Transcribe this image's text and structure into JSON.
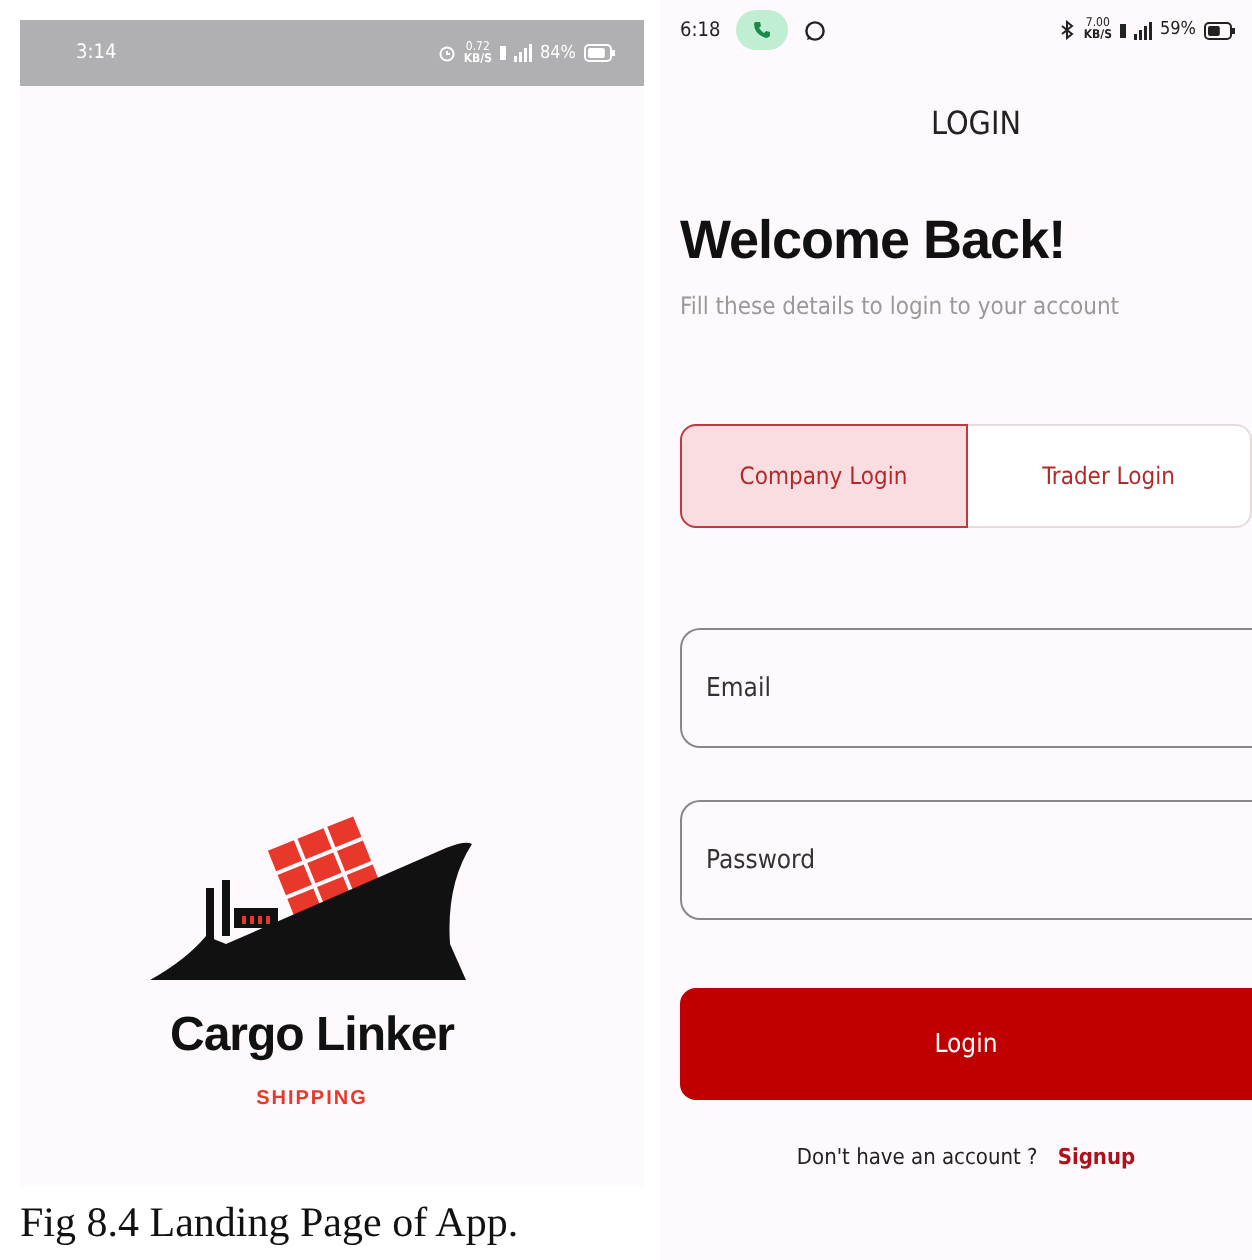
{
  "landing_screen": {
    "status_bar": {
      "time": "3:14",
      "speed": "0.72",
      "speed_unit": "KB/S",
      "battery": "84%"
    },
    "logo": {
      "name": "Cargo Linker",
      "tagline": "SHIPPING"
    }
  },
  "caption": "Fig 8.4 Landing Page of App.",
  "login_screen": {
    "status_bar": {
      "time": "6:18",
      "speed": "7.00",
      "speed_unit": "KB/S",
      "battery": "59%",
      "call_active": true
    },
    "title": "LOGIN",
    "heading": "Welcome Back!",
    "subtitle": "Fill these details to login to your account",
    "tabs": [
      {
        "label": "Company Login",
        "selected": true
      },
      {
        "label": "Trader Login",
        "selected": false
      }
    ],
    "fields": [
      {
        "placeholder": "Email"
      },
      {
        "placeholder": "Password"
      }
    ],
    "login_button": "Login",
    "signup_prompt": "Don't have an account ?",
    "signup_link": "Signup"
  }
}
